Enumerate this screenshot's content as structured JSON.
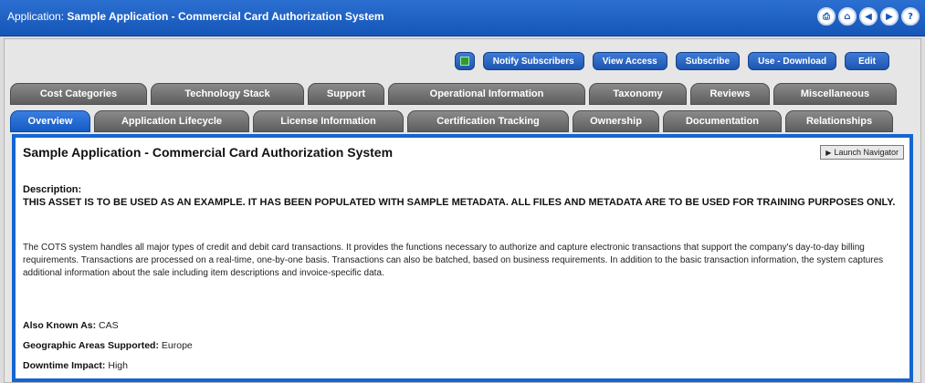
{
  "window": {
    "title_prefix": "Application:",
    "title_name": "Sample Application - Commercial Card Authorization System",
    "icons": [
      "print-icon",
      "home-icon",
      "back-icon",
      "forward-icon",
      "help-icon"
    ]
  },
  "actions": {
    "notify": "Notify Subscribers",
    "view_access": "View Access",
    "subscribe": "Subscribe",
    "use_download": "Use - Download",
    "edit": "Edit"
  },
  "tabs_row1": [
    "Cost Categories",
    "Technology Stack",
    "Support",
    "Operational Information",
    "Taxonomy",
    "Reviews",
    "Miscellaneous"
  ],
  "tabs_row2": [
    "Overview",
    "Application Lifecycle",
    "License Information",
    "Certification Tracking",
    "Ownership",
    "Documentation",
    "Relationships"
  ],
  "panel": {
    "heading": "Sample Application - Commercial Card Authorization System",
    "launch_label": "Launch Navigator",
    "description_label": "Description:",
    "description_text": "THIS ASSET IS TO BE USED AS AN EXAMPLE. IT HAS BEEN POPULATED WITH SAMPLE METADATA. ALL FILES AND METADATA ARE TO BE USED FOR TRAINING PURPOSES ONLY.",
    "body_text": "The COTS system handles all major types of credit and debit card transactions. It provides the functions necessary to authorize and capture electronic transactions that support the company's day-to-day billing requirements. Transactions are processed on a real-time, one-by-one basis. Transactions can also be batched, based on business requirements. In addition to the basic transaction information, the system captures additional information about the sale including item descriptions and invoice-specific data.",
    "fields": [
      {
        "label": "Also Known As:",
        "value": "CAS"
      },
      {
        "label": "Geographic Areas Supported:",
        "value": "Europe"
      },
      {
        "label": "Downtime Impact:",
        "value": "High"
      }
    ]
  }
}
